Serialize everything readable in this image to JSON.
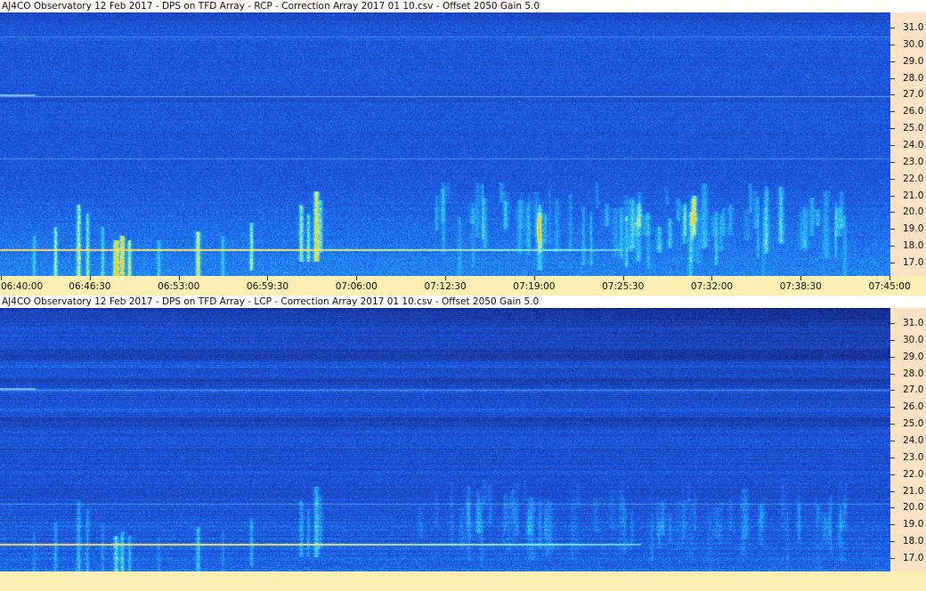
{
  "chart_data": [
    {
      "type": "heatmap",
      "title": "AJ4CO Observatory 12 Feb 2017  -  DPS on TFD Array  -  RCP  -  Correction Array 2017 01 10.csv  -  Offset 2050  Gain 5.0",
      "y_ticks": [
        "31.0",
        "30.0",
        "29.0",
        "28.0",
        "27.0",
        "26.0",
        "25.0",
        "24.0",
        "23.0",
        "22.0",
        "21.0",
        "20.0",
        "19.0",
        "18.0",
        "17.0"
      ],
      "x_ticks": [
        "06:40:00",
        "06:46:30",
        "06:53:00",
        "06:59:30",
        "07:06:00",
        "07:12:30",
        "07:19:00",
        "07:25:30",
        "07:32:00",
        "07:38:30",
        "07:45:00"
      ],
      "x_range": [
        "06:40:00",
        "07:45:00"
      ],
      "ylim": [
        16.2,
        31.9
      ]
    },
    {
      "type": "heatmap",
      "title": "AJ4CO Observatory 12 Feb 2017  -  DPS on TFD Array  -  LCP  -  Correction Array 2017 01 10.csv  -  Offset 2050  Gain 5.0",
      "y_ticks": [
        "31.0",
        "30.0",
        "29.0",
        "28.0",
        "27.0",
        "26.0",
        "25.0",
        "24.0",
        "23.0",
        "22.0",
        "21.0",
        "20.0",
        "19.0",
        "18.0",
        "17.0"
      ],
      "ylim": [
        16.2,
        31.9
      ]
    }
  ],
  "colors": {
    "axis_bg": "#fde2c4",
    "time_axis_bg": "#fcefb4",
    "spectrogram_base": "#1e46d2"
  }
}
